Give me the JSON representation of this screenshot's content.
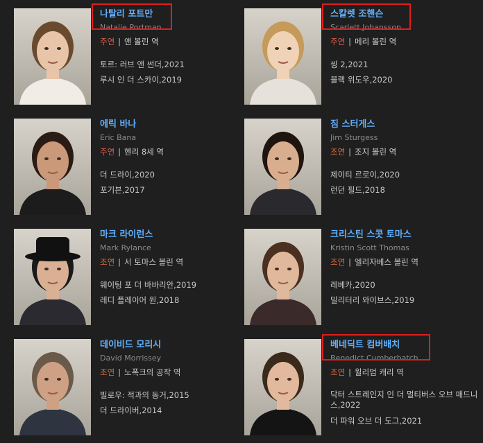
{
  "cast": [
    {
      "name_ko": "나탈리 포트만",
      "name_en": "Natalie Portman",
      "role_type": "주연",
      "role": "앤 볼린 역",
      "works": [
        "토르: 러브 앤 썬더,2021",
        "루시 인 더 스카이,2019"
      ],
      "highlighted": true
    },
    {
      "name_ko": "스칼렛 조핸슨",
      "name_en": "Scarlett Johansson",
      "role_type": "주연",
      "role": "메리 볼린 역",
      "works": [
        "씽 2,2021",
        "블랙 위도우,2020"
      ],
      "highlighted": true
    },
    {
      "name_ko": "에릭 바나",
      "name_en": "Eric Bana",
      "role_type": "주연",
      "role": "헨리 8세 역",
      "works": [
        "더 드라이,2020",
        "포기븐,2017"
      ],
      "highlighted": false
    },
    {
      "name_ko": "짐 스터게스",
      "name_en": "Jim Sturgess",
      "role_type": "조연",
      "role": "조지 볼린 역",
      "works": [
        "제이티 르로이,2020",
        "런던 필드,2018"
      ],
      "highlighted": false
    },
    {
      "name_ko": "마크 라이런스",
      "name_en": "Mark Rylance",
      "role_type": "조연",
      "role": "서 토마스 볼린 역",
      "works": [
        "웨이팅 포 더 바바리안,2019",
        "레디 플레이어 원,2018"
      ],
      "highlighted": false
    },
    {
      "name_ko": "크리스틴 스콧 토마스",
      "name_en": "Kristin Scott Thomas",
      "role_type": "조연",
      "role": "엘리자베스 볼린 역",
      "works": [
        "레베카,2020",
        "밀리터리 와이브스,2019"
      ],
      "highlighted": false
    },
    {
      "name_ko": "데이비드 모리시",
      "name_en": "David Morrissey",
      "role_type": "조연",
      "role": "노폭크의 공작 역",
      "works": [
        "빌로우: 적과의 동거,2015",
        "더 드라이버,2014"
      ],
      "highlighted": false
    },
    {
      "name_ko": "베네딕트 컴버배치",
      "name_en": "Benedict Cumberbatch",
      "role_type": "조연",
      "role": "윌리엄 캐리 역",
      "works": [
        "닥터 스트레인지 인 더 멀티버스 오브 매드니스,2022",
        "더 파워 오브 더 도그,2021"
      ],
      "highlighted": true
    }
  ],
  "colors": {
    "background": "#1f1f1f",
    "name_link": "#5fb0ff",
    "lead_role": "#e25a4c",
    "support_role": "#e36a3a",
    "highlight_box": "#e01e1e"
  }
}
